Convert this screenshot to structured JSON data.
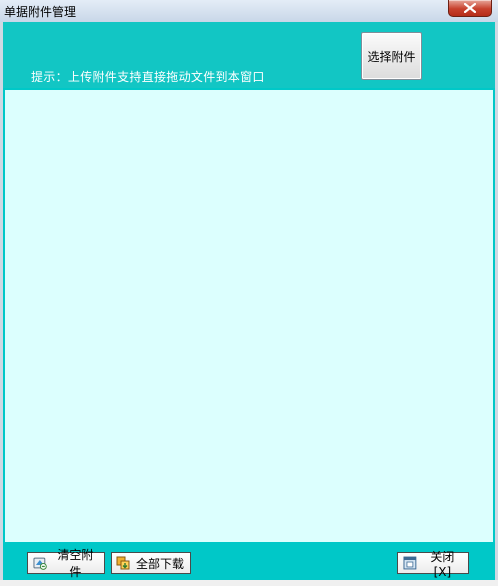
{
  "window": {
    "title": "单据附件管理"
  },
  "header": {
    "hint": "提示：上传附件支持直接拖动文件到本窗口",
    "select_button": "选择附件"
  },
  "footer": {
    "clear_button": "清空附件",
    "download_all_button": "全部下载",
    "close_button": "关闭[X]"
  },
  "colors": {
    "header_teal": "#12c6c4",
    "list_background": "#dcfffe",
    "title_close": "#c7402d"
  },
  "icons": {
    "titlebar_close": "close-icon",
    "clear": "clear-attachments-icon",
    "download": "download-all-icon",
    "close": "close-dialog-icon"
  }
}
